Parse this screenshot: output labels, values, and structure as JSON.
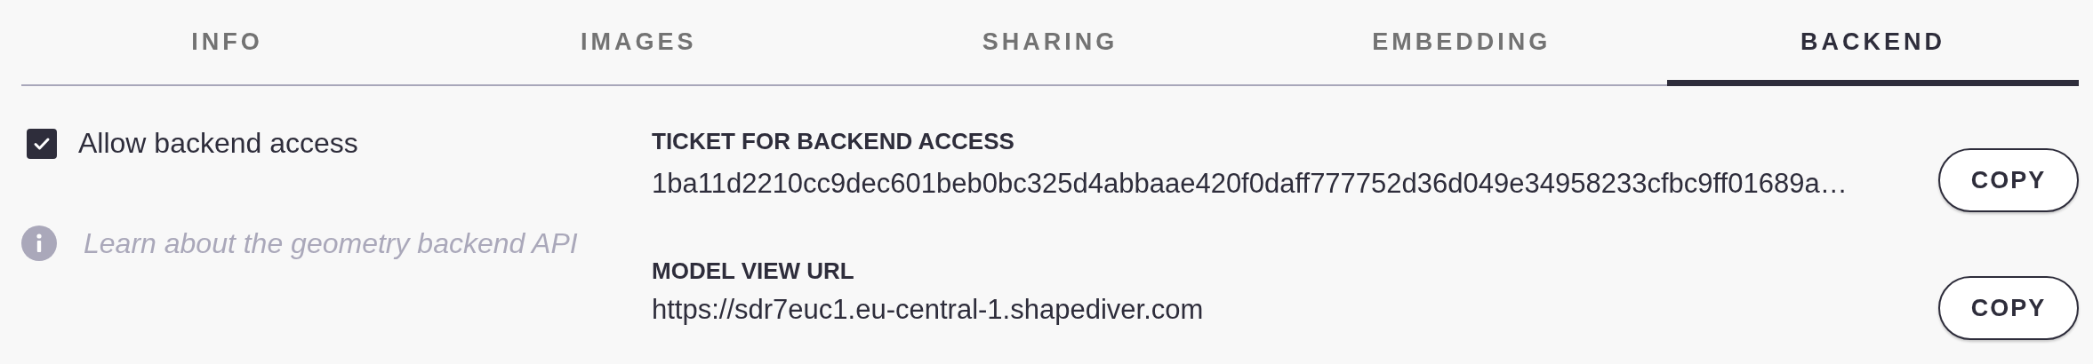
{
  "tabs": [
    {
      "label": "INFO",
      "selected": false
    },
    {
      "label": "IMAGES",
      "selected": false
    },
    {
      "label": "SHARING",
      "selected": false
    },
    {
      "label": "EMBEDDING",
      "selected": false
    },
    {
      "label": "BACKEND",
      "selected": true
    }
  ],
  "backend_access": {
    "label": "Allow backend access",
    "checked": true
  },
  "info_link": "Learn about the geometry backend API",
  "fields": [
    {
      "title": "TICKET FOR BACKEND ACCESS",
      "value": "1ba11d2210cc9dec601beb0bc325d4abbaae420f0daff777752d36d049e34958233cfbc9ff01689a…",
      "button": "COPY"
    },
    {
      "title": "MODEL VIEW URL",
      "value": "https://sdr7euc1.eu-central-1.shapediver.com",
      "button": "COPY"
    }
  ]
}
